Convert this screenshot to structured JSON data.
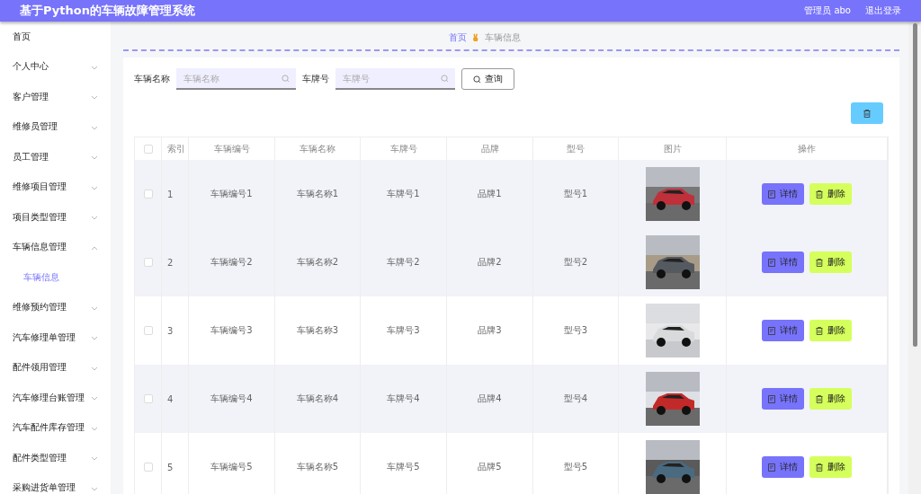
{
  "header": {
    "title": "基于Python的车辆故障管理系统",
    "user": "管理员 abo",
    "logout": "退出登录"
  },
  "sidebar": {
    "items": [
      {
        "kind": "link",
        "label": "首页",
        "selected": false
      },
      {
        "kind": "group",
        "label": "个人中心",
        "selected": false,
        "expanded": false
      },
      {
        "kind": "group",
        "label": "客户管理",
        "selected": false,
        "expanded": false
      },
      {
        "kind": "group",
        "label": "维修员管理",
        "selected": false,
        "expanded": false
      },
      {
        "kind": "group",
        "label": "员工管理",
        "selected": false,
        "expanded": false
      },
      {
        "kind": "group",
        "label": "维修项目管理",
        "selected": false,
        "expanded": false
      },
      {
        "kind": "group",
        "label": "项目类型管理",
        "selected": false,
        "expanded": false
      },
      {
        "kind": "group",
        "label": "车辆信息管理",
        "selected": false,
        "expanded": true,
        "children": [
          {
            "label": "车辆信息",
            "selected": true
          }
        ]
      },
      {
        "kind": "group",
        "label": "维修预约管理",
        "selected": false,
        "expanded": false
      },
      {
        "kind": "group",
        "label": "汽车修理单管理",
        "selected": false,
        "expanded": false
      },
      {
        "kind": "group",
        "label": "配件领用管理",
        "selected": false,
        "expanded": false
      },
      {
        "kind": "group",
        "label": "汽车修理台账管理",
        "selected": false,
        "expanded": false
      },
      {
        "kind": "group",
        "label": "汽车配件库存管理",
        "selected": false,
        "expanded": false
      },
      {
        "kind": "group",
        "label": "配件类型管理",
        "selected": false,
        "expanded": false
      },
      {
        "kind": "group",
        "label": "采购进货单管理",
        "selected": false,
        "expanded": false
      }
    ]
  },
  "breadcrumb": [
    {
      "label": "首页"
    },
    {
      "label": "车辆信息"
    }
  ],
  "search": {
    "fields": [
      {
        "label": "车辆名称",
        "placeholder": "车辆名称"
      },
      {
        "label": "车牌号",
        "placeholder": "车牌号"
      }
    ],
    "button": "查询"
  },
  "table": {
    "header_checked": false,
    "columns": [
      "索引",
      "车辆编号",
      "车辆名称",
      "车牌号",
      "品牌",
      "型号",
      "图片",
      "操作"
    ],
    "rows": [
      {
        "checked": false,
        "highlighted": true,
        "cells": [
          "1",
          "车辆编号1",
          "车辆名称1",
          "车牌号1",
          "品牌1",
          "型号1"
        ],
        "actions": [
          "详情",
          "删除"
        ]
      },
      {
        "checked": false,
        "highlighted": true,
        "cells": [
          "2",
          "车辆编号2",
          "车辆名称2",
          "车牌号2",
          "品牌2",
          "型号2"
        ],
        "actions": [
          "详情",
          "删除"
        ]
      },
      {
        "checked": false,
        "highlighted": false,
        "cells": [
          "3",
          "车辆编号3",
          "车辆名称3",
          "车牌号3",
          "品牌3",
          "型号3"
        ],
        "actions": [
          "详情",
          "删除"
        ]
      },
      {
        "checked": false,
        "highlighted": true,
        "cells": [
          "4",
          "车辆编号4",
          "车辆名称4",
          "车牌号4",
          "品牌4",
          "型号4"
        ],
        "actions": [
          "详情",
          "删除"
        ]
      },
      {
        "checked": false,
        "highlighted": false,
        "cells": [
          "5",
          "车辆编号5",
          "车辆名称5",
          "车牌号5",
          "品牌5",
          "型号5"
        ],
        "actions": [
          "详情",
          "删除"
        ]
      }
    ]
  }
}
